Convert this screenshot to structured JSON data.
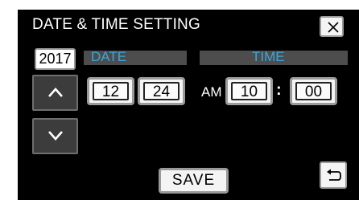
{
  "header": {
    "title": "DATE & TIME SETTING",
    "close_icon": "close-icon"
  },
  "year": "2017",
  "date": {
    "label": "DATE",
    "month": "12",
    "day": "24"
  },
  "time": {
    "label": "TIME",
    "ampm": "AM",
    "hour": "10",
    "separator": ":",
    "minute": "00"
  },
  "controls": {
    "up_icon": "chevron-up-icon",
    "down_icon": "chevron-down-icon",
    "save_label": "SAVE",
    "back_icon": "return-icon"
  },
  "colors": {
    "background": "#000000",
    "accent": "#3ba6dd",
    "button_face": "#f4f4f4",
    "section_bar": "#4d4d4d"
  }
}
